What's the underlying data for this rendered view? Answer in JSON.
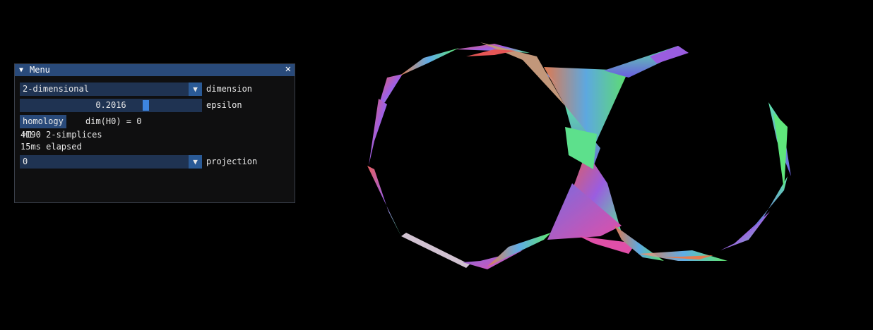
{
  "window": {
    "title": "Menu",
    "collapse_glyph": "▼",
    "close_glyph": "✕"
  },
  "dimension": {
    "value": "2-dimensional",
    "label": "dimension",
    "arrow": "▼"
  },
  "epsilon": {
    "value": "0.2016",
    "label": "epsilon",
    "fraction": 0.7
  },
  "homology": {
    "button_label": "homology H1",
    "result": "dim(H0) = 0"
  },
  "stats": {
    "simplices": "4190 2-simplices",
    "elapsed": "15ms elapsed"
  },
  "projection": {
    "value": "0",
    "label": "projection",
    "arrow": "▼"
  },
  "colors": {
    "background": "#000000",
    "window_bg": "#0f0f10",
    "title_bg": "#294a7a",
    "frame_bg": "#1f3352",
    "accent": "#3d85e0"
  }
}
